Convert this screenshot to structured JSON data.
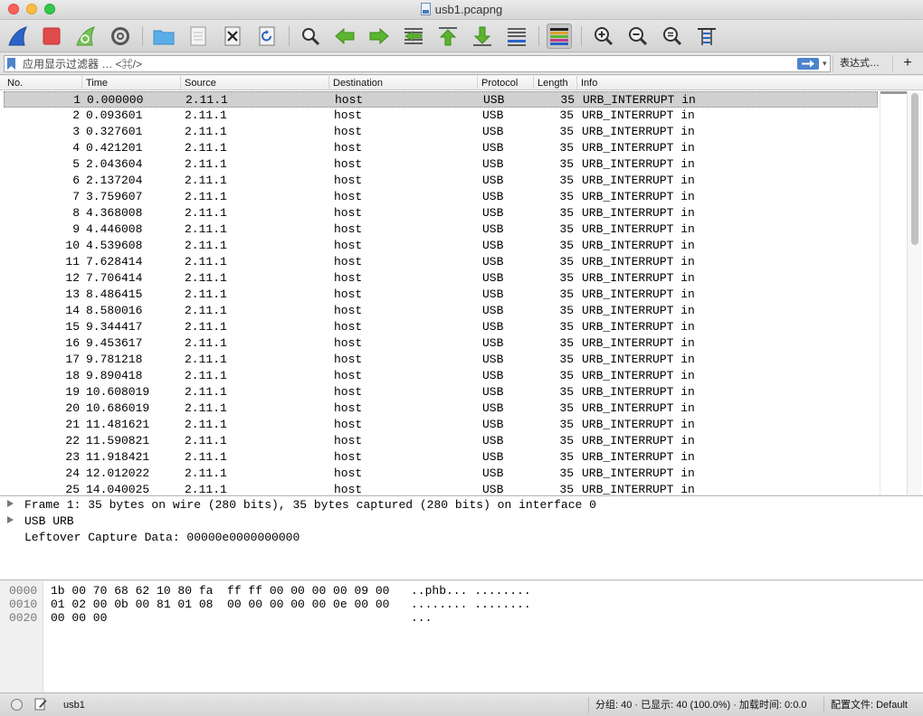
{
  "window": {
    "title": "usb1.pcapng",
    "icons": {
      "close": "close-dot",
      "minimize": "minimize-dot",
      "zoom": "zoom-dot",
      "file": "pcapng-file-icon"
    }
  },
  "toolbar": {
    "buttons": [
      {
        "name": "start-capture",
        "icon": "shark-fin-icon"
      },
      {
        "name": "stop-capture",
        "icon": "stop-square-icon"
      },
      {
        "name": "restart-capture",
        "icon": "restart-fin-icon"
      },
      {
        "name": "capture-options",
        "icon": "gear-icon"
      },
      {
        "name": "open-file",
        "icon": "folder-icon"
      },
      {
        "name": "save-file",
        "icon": "document-icon"
      },
      {
        "name": "close-file",
        "icon": "close-file-icon"
      },
      {
        "name": "reload-file",
        "icon": "reload-icon"
      },
      {
        "name": "find-packet",
        "icon": "magnifier-icon"
      },
      {
        "name": "go-back",
        "icon": "arrow-left-icon"
      },
      {
        "name": "go-forward",
        "icon": "arrow-right-icon"
      },
      {
        "name": "go-to-packet",
        "icon": "goto-packet-icon"
      },
      {
        "name": "go-first",
        "icon": "arrow-up-icon"
      },
      {
        "name": "go-last",
        "icon": "arrow-down-icon"
      },
      {
        "name": "auto-scroll",
        "icon": "autoscroll-icon"
      },
      {
        "name": "colorize",
        "icon": "colorize-icon"
      },
      {
        "name": "zoom-in",
        "icon": "zoom-in-icon"
      },
      {
        "name": "zoom-out",
        "icon": "zoom-out-icon"
      },
      {
        "name": "zoom-normal",
        "icon": "zoom-normal-icon"
      },
      {
        "name": "resize-columns",
        "icon": "resize-columns-icon"
      }
    ]
  },
  "filter": {
    "placeholder": "应用显示过滤器 … <⌘/>",
    "value": "",
    "expression_label": "表达式…",
    "add_label": "+",
    "dropdown_glyph": "▾"
  },
  "packet_list": {
    "columns": [
      "No.",
      "Time",
      "Source",
      "Destination",
      "Protocol",
      "Length",
      "Info"
    ],
    "selected_index": 0,
    "rows": [
      {
        "no": "1",
        "time": "0.000000",
        "source": "2.11.1",
        "destination": "host",
        "protocol": "USB",
        "length": "35",
        "info": "URB_INTERRUPT in"
      },
      {
        "no": "2",
        "time": "0.093601",
        "source": "2.11.1",
        "destination": "host",
        "protocol": "USB",
        "length": "35",
        "info": "URB_INTERRUPT in"
      },
      {
        "no": "3",
        "time": "0.327601",
        "source": "2.11.1",
        "destination": "host",
        "protocol": "USB",
        "length": "35",
        "info": "URB_INTERRUPT in"
      },
      {
        "no": "4",
        "time": "0.421201",
        "source": "2.11.1",
        "destination": "host",
        "protocol": "USB",
        "length": "35",
        "info": "URB_INTERRUPT in"
      },
      {
        "no": "5",
        "time": "2.043604",
        "source": "2.11.1",
        "destination": "host",
        "protocol": "USB",
        "length": "35",
        "info": "URB_INTERRUPT in"
      },
      {
        "no": "6",
        "time": "2.137204",
        "source": "2.11.1",
        "destination": "host",
        "protocol": "USB",
        "length": "35",
        "info": "URB_INTERRUPT in"
      },
      {
        "no": "7",
        "time": "3.759607",
        "source": "2.11.1",
        "destination": "host",
        "protocol": "USB",
        "length": "35",
        "info": "URB_INTERRUPT in"
      },
      {
        "no": "8",
        "time": "4.368008",
        "source": "2.11.1",
        "destination": "host",
        "protocol": "USB",
        "length": "35",
        "info": "URB_INTERRUPT in"
      },
      {
        "no": "9",
        "time": "4.446008",
        "source": "2.11.1",
        "destination": "host",
        "protocol": "USB",
        "length": "35",
        "info": "URB_INTERRUPT in"
      },
      {
        "no": "10",
        "time": "4.539608",
        "source": "2.11.1",
        "destination": "host",
        "protocol": "USB",
        "length": "35",
        "info": "URB_INTERRUPT in"
      },
      {
        "no": "11",
        "time": "7.628414",
        "source": "2.11.1",
        "destination": "host",
        "protocol": "USB",
        "length": "35",
        "info": "URB_INTERRUPT in"
      },
      {
        "no": "12",
        "time": "7.706414",
        "source": "2.11.1",
        "destination": "host",
        "protocol": "USB",
        "length": "35",
        "info": "URB_INTERRUPT in"
      },
      {
        "no": "13",
        "time": "8.486415",
        "source": "2.11.1",
        "destination": "host",
        "protocol": "USB",
        "length": "35",
        "info": "URB_INTERRUPT in"
      },
      {
        "no": "14",
        "time": "8.580016",
        "source": "2.11.1",
        "destination": "host",
        "protocol": "USB",
        "length": "35",
        "info": "URB_INTERRUPT in"
      },
      {
        "no": "15",
        "time": "9.344417",
        "source": "2.11.1",
        "destination": "host",
        "protocol": "USB",
        "length": "35",
        "info": "URB_INTERRUPT in"
      },
      {
        "no": "16",
        "time": "9.453617",
        "source": "2.11.1",
        "destination": "host",
        "protocol": "USB",
        "length": "35",
        "info": "URB_INTERRUPT in"
      },
      {
        "no": "17",
        "time": "9.781218",
        "source": "2.11.1",
        "destination": "host",
        "protocol": "USB",
        "length": "35",
        "info": "URB_INTERRUPT in"
      },
      {
        "no": "18",
        "time": "9.890418",
        "source": "2.11.1",
        "destination": "host",
        "protocol": "USB",
        "length": "35",
        "info": "URB_INTERRUPT in"
      },
      {
        "no": "19",
        "time": "10.608019",
        "source": "2.11.1",
        "destination": "host",
        "protocol": "USB",
        "length": "35",
        "info": "URB_INTERRUPT in"
      },
      {
        "no": "20",
        "time": "10.686019",
        "source": "2.11.1",
        "destination": "host",
        "protocol": "USB",
        "length": "35",
        "info": "URB_INTERRUPT in"
      },
      {
        "no": "21",
        "time": "11.481621",
        "source": "2.11.1",
        "destination": "host",
        "protocol": "USB",
        "length": "35",
        "info": "URB_INTERRUPT in"
      },
      {
        "no": "22",
        "time": "11.590821",
        "source": "2.11.1",
        "destination": "host",
        "protocol": "USB",
        "length": "35",
        "info": "URB_INTERRUPT in"
      },
      {
        "no": "23",
        "time": "11.918421",
        "source": "2.11.1",
        "destination": "host",
        "protocol": "USB",
        "length": "35",
        "info": "URB_INTERRUPT in"
      },
      {
        "no": "24",
        "time": "12.012022",
        "source": "2.11.1",
        "destination": "host",
        "protocol": "USB",
        "length": "35",
        "info": "URB_INTERRUPT in"
      },
      {
        "no": "25",
        "time": "14.040025",
        "source": "2.11.1",
        "destination": "host",
        "protocol": "USB",
        "length": "35",
        "info": "URB_INTERRUPT in"
      }
    ]
  },
  "details": [
    {
      "text": "Frame 1: 35 bytes on wire (280 bits), 35 bytes captured (280 bits) on interface 0",
      "expandable": true
    },
    {
      "text": "USB URB",
      "expandable": true
    },
    {
      "text": "Leftover Capture Data: 00000e0000000000",
      "expandable": false
    }
  ],
  "bytes": [
    {
      "offset": "0000",
      "hex": "1b 00 70 68 62 10 80 fa  ff ff 00 00 00 00 09 00",
      "ascii": "..phb... ........"
    },
    {
      "offset": "0010",
      "hex": "01 02 00 0b 00 81 01 08  00 00 00 00 00 0e 00 00",
      "ascii": "........ ........"
    },
    {
      "offset": "0020",
      "hex": "00 00 00",
      "ascii": "..."
    }
  ],
  "status": {
    "file": "usb1",
    "stats": "分组: 40 · 已显示: 40 (100.0%) · 加载时间: 0:0.0",
    "profile": "配置文件: Default"
  },
  "colors": {
    "selected_row": "#d0d0d0",
    "apply_button": "#4e83cc",
    "stop_red": "#e24b4b",
    "fin_blue": "#2a63c6",
    "arrow_green": "#5bb52f",
    "folder_blue": "#5aaee8"
  }
}
